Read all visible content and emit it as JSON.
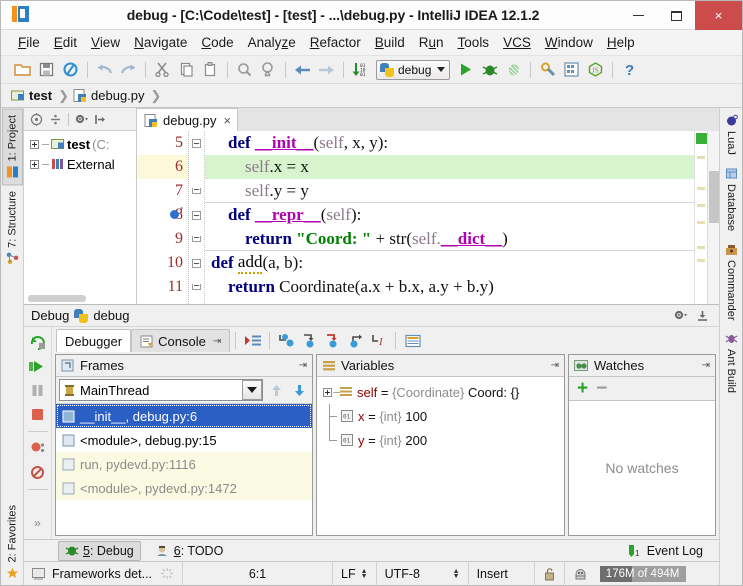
{
  "window": {
    "title": "debug - [C:\\Code\\test] - [test] - ...\\debug.py - IntelliJ IDEA 12.1.2",
    "minimize_label": "–",
    "maximize_label": "□",
    "close_label": "×"
  },
  "menubar": {
    "items": [
      {
        "label": "File",
        "mnemonic": "F"
      },
      {
        "label": "Edit",
        "mnemonic": "E"
      },
      {
        "label": "View",
        "mnemonic": "V"
      },
      {
        "label": "Navigate",
        "mnemonic": "N"
      },
      {
        "label": "Code",
        "mnemonic": "C"
      },
      {
        "label": "Analyze",
        "mnemonic": "z"
      },
      {
        "label": "Refactor",
        "mnemonic": "R"
      },
      {
        "label": "Build",
        "mnemonic": "B"
      },
      {
        "label": "Run",
        "mnemonic": "R"
      },
      {
        "label": "Tools",
        "mnemonic": "T"
      },
      {
        "label": "VCS",
        "mnemonic": ""
      },
      {
        "label": "Window",
        "mnemonic": "W"
      },
      {
        "label": "Help",
        "mnemonic": "H"
      }
    ]
  },
  "toolbar": {
    "buttons": [
      "open-folder-icon",
      "save-all-icon",
      "sync-icon",
      "undo-icon",
      "redo-icon",
      "cut-icon",
      "copy-icon",
      "paste-icon",
      "find-icon",
      "find-usages-icon",
      "back-icon",
      "forward-icon",
      "compile-icon"
    ],
    "run_config": "debug",
    "run_config_icon": "python-icon",
    "run_label": "run-icon",
    "debug_label": "debug-icon",
    "coverage_label": "run-with-coverage-icon",
    "settings_icon": "settings-icon",
    "project-structure_icon": "project-structure-icon",
    "node_icon": "nodejs-icon",
    "help_icon": "help-icon"
  },
  "breadcrumb": {
    "items": [
      {
        "label": "test",
        "icon": "module-icon",
        "selected": true
      },
      {
        "label": "debug.py",
        "icon": "python-file-icon",
        "selected": false
      }
    ]
  },
  "left_tabs": [
    {
      "label": "1: Project",
      "mnemonic": "1",
      "icon": "project-icon",
      "active": true
    },
    {
      "label": "7: Structure",
      "mnemonic": "7",
      "icon": "structure-icon",
      "active": false
    },
    {
      "label": "2: Favorites",
      "mnemonic": "2",
      "icon": "star-icon",
      "active": false
    }
  ],
  "right_tabs": [
    {
      "label": "LuaJ",
      "icon": "luaj-icon"
    },
    {
      "label": "Database",
      "icon": "database-icon"
    },
    {
      "label": "Commander",
      "icon": "commander-icon"
    },
    {
      "label": "Ant Build",
      "icon": "ant-icon"
    }
  ],
  "project_pane": {
    "toolbar_buttons": [
      "target-icon",
      "collapse-all-icon",
      "settings-icon",
      "hide-icon"
    ],
    "tree": [
      {
        "label": "test",
        "suffix": "(C:",
        "icon": "module-icon",
        "bold": true
      },
      {
        "label": "External",
        "suffix": "",
        "icon": "library-icon",
        "bold": false
      }
    ]
  },
  "editor": {
    "tab": {
      "label": "debug.py",
      "icon": "python-file-icon",
      "close": "×"
    },
    "lines": [
      {
        "num": "5",
        "highlight": false,
        "breakpoint": false,
        "current": false,
        "fold": "open",
        "sep": false,
        "tokens": [
          {
            "t": "indent",
            "v": "    "
          },
          {
            "t": "k",
            "v": "def "
          },
          {
            "t": "dun",
            "v": "__init__"
          },
          {
            "t": "pl",
            "v": "("
          },
          {
            "t": "slf",
            "v": "self"
          },
          {
            "t": "pl",
            "v": ", x, y):"
          }
        ]
      },
      {
        "num": "6",
        "highlight": true,
        "breakpoint": false,
        "current": true,
        "fold": "none",
        "sep": false,
        "tokens": [
          {
            "t": "indent",
            "v": "        "
          },
          {
            "t": "slf",
            "v": "self"
          },
          {
            "t": "pl",
            "v": ".x = x"
          }
        ]
      },
      {
        "num": "7",
        "highlight": false,
        "breakpoint": false,
        "current": false,
        "fold": "end",
        "sep": true,
        "tokens": [
          {
            "t": "indent",
            "v": "        "
          },
          {
            "t": "slf",
            "v": "self"
          },
          {
            "t": "pl",
            "v": ".y = y"
          }
        ]
      },
      {
        "num": "8",
        "highlight": false,
        "breakpoint": true,
        "current": false,
        "fold": "open",
        "sep": false,
        "tokens": [
          {
            "t": "indent",
            "v": "    "
          },
          {
            "t": "k",
            "v": "def "
          },
          {
            "t": "dun",
            "v": "__repr__"
          },
          {
            "t": "pl",
            "v": "("
          },
          {
            "t": "slf",
            "v": "self"
          },
          {
            "t": "pl",
            "v": "):"
          }
        ]
      },
      {
        "num": "9",
        "highlight": false,
        "breakpoint": false,
        "current": false,
        "fold": "end",
        "sep": true,
        "tokens": [
          {
            "t": "indent",
            "v": "        "
          },
          {
            "t": "k",
            "v": "return "
          },
          {
            "t": "str",
            "v": "\"Coord: \""
          },
          {
            "t": "pl",
            "v": " + str("
          },
          {
            "t": "slf",
            "v": "self."
          },
          {
            "t": "dun",
            "v": "__dict__"
          },
          {
            "t": "pl",
            "v": ")"
          }
        ]
      },
      {
        "num": "10",
        "highlight": false,
        "breakpoint": false,
        "current": false,
        "fold": "open",
        "sep": false,
        "tokens": [
          {
            "t": "k",
            "v": "def "
          },
          {
            "t": "squig",
            "v": "add"
          },
          {
            "t": "pl",
            "v": "(a, b):"
          }
        ]
      },
      {
        "num": "11",
        "highlight": false,
        "breakpoint": false,
        "current": false,
        "fold": "end",
        "sep": false,
        "tokens": [
          {
            "t": "indent",
            "v": "    "
          },
          {
            "t": "k",
            "v": "return "
          },
          {
            "t": "pl",
            "v": "Coordinate(a.x + b.x, a.y + b.y)"
          }
        ]
      }
    ]
  },
  "debug": {
    "header_title": "Debug",
    "header_config": "debug",
    "header_icon": "python-icon",
    "settings_icon": "settings-icon",
    "hide_icon": "hide-icon",
    "rail_buttons": [
      "rerun-icon",
      "resume-icon",
      "pause-icon",
      "stop-icon",
      "view-breakpoints-icon",
      "mute-breakpoints-icon",
      "more-icon"
    ],
    "tabs": [
      {
        "label": "Debugger",
        "icon": "debugger-icon",
        "active": true
      },
      {
        "label": "Console",
        "icon": "console-icon",
        "active": false
      }
    ],
    "step_buttons": [
      "show-execution-point-icon",
      "step-over-icon",
      "step-into-icon",
      "force-step-into-icon",
      "step-out-icon",
      "run-to-cursor-icon",
      "evaluate-expression-icon"
    ],
    "frames": {
      "title": "Frames",
      "title_icon": "frames-icon",
      "thread": "MainThread",
      "thread_icon": "thread-icon",
      "up_icon": "arrow-up-icon",
      "down_icon": "arrow-down-icon",
      "items": [
        {
          "label": "__init__, debug.py:6",
          "selected": true,
          "library": false
        },
        {
          "label": "<module>, debug.py:15",
          "selected": false,
          "library": false
        },
        {
          "label": "run, pydevd.py:1116",
          "selected": false,
          "library": true
        },
        {
          "label": "<module>, pydevd.py:1472",
          "selected": false,
          "library": true
        }
      ]
    },
    "variables": {
      "title": "Variables",
      "title_icon": "variables-icon",
      "items": [
        {
          "indent": 0,
          "expandable": true,
          "last": false,
          "icon": "object-icon",
          "name": "self",
          "type": "{Coordinate}",
          "value": "Coord: {}"
        },
        {
          "indent": 1,
          "expandable": false,
          "last": false,
          "icon": "primitive-icon",
          "name": "x",
          "type": "{int}",
          "value": "100"
        },
        {
          "indent": 1,
          "expandable": false,
          "last": true,
          "icon": "primitive-icon",
          "name": "y",
          "type": "{int}",
          "value": "200"
        }
      ]
    },
    "watches": {
      "title": "Watches",
      "title_icon": "watches-icon",
      "add_label": "+",
      "remove_label": "−",
      "empty_text": "No watches"
    }
  },
  "toolwindow_bar": {
    "buttons": [
      {
        "label": "5: Debug",
        "mnemonic": "5",
        "icon": "debug-icon",
        "active": true
      },
      {
        "label": "6: TODO",
        "mnemonic": "6",
        "icon": "todo-icon",
        "active": false
      }
    ],
    "event_log": {
      "label": "Event Log",
      "count": "1",
      "icon": "event-log-icon"
    }
  },
  "statusbar": {
    "frameworks": "Frameworks det...",
    "frameworks_icon": "frameworks-icon",
    "refresh_icon": "busy-icon",
    "caret_position": "6:1",
    "line_separator": "LF",
    "encoding": "UTF-8",
    "insert_mode": "Insert",
    "lock_icon": "lock-icon",
    "hector_icon": "hector-icon",
    "memory": "176M of 494M"
  }
}
